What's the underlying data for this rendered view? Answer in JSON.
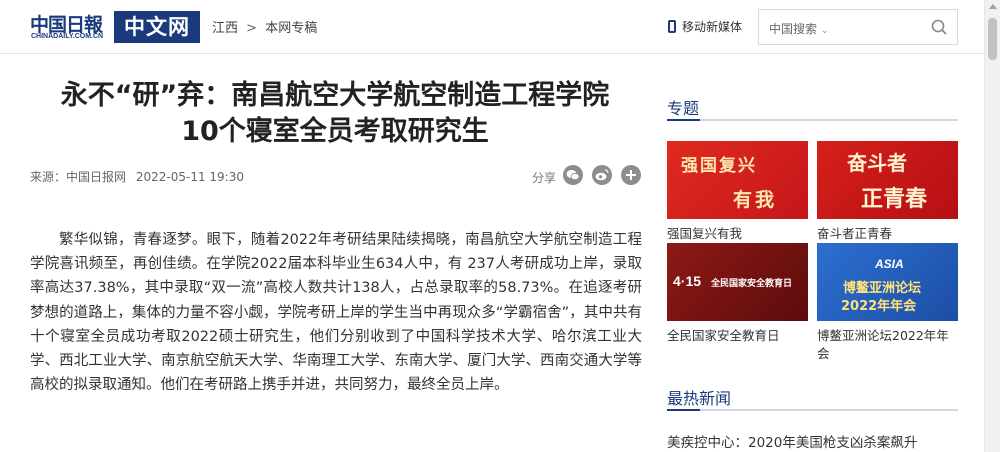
{
  "header": {
    "logo_cn": "中国日報",
    "logo_url_text": "CHINADAILY.COM.CN",
    "logo_zwb": "中文网",
    "breadcrumb": [
      "江西",
      "本网专稿"
    ],
    "breadcrumb_sep": ">",
    "mobile_label": "移动新媒体",
    "search_placeholder": "中国搜索"
  },
  "article": {
    "title_line1": "永不“研”弃：南昌航空大学航空制造工程学院",
    "title_line2": "10个寝室全员考取研究生",
    "source": "来源：中国日报网",
    "datetime": "2022-05-11 19:30",
    "share_label": "分享",
    "body": "繁华似锦，青春逐梦。眼下，随着2022年考研结果陆续揭晓，南昌航空大学航空制造工程学院喜讯频至，再创佳绩。在学院2022届本科毕业生634人中，有 237人考研成功上岸，录取率高达37.38%，其中录取“双一流”高校人数共计138人，占总录取率的58.73%。在追逐考研梦想的道路上，集体的力量不容小觑，学院考研上岸的学生当中再现众多“学霸宿舍”，其中共有十个寝室全员成功考取2022硕士研究生，他们分别收到了中国科学技术大学、哈尔滨工业大学、西北工业大学、南京航空航天大学、华南理工大学、东南大学、厦门大学、西南交通大学等高校的拟录取通知。他们在考研路上携手并进，共同努力，最终全员上岸。"
  },
  "sidebar": {
    "topics_heading": "专题",
    "topics": [
      {
        "caption": "强国复兴有我",
        "img_text1": "强国复兴",
        "img_text2": "有我"
      },
      {
        "caption": "奋斗者正青春",
        "img_text1": "奋斗者",
        "img_text2": "正青春"
      },
      {
        "caption": "全民国家安全教育日",
        "img_text1": "4·15",
        "img_text2": "全民国家安全教育日"
      },
      {
        "caption": "博鳌亚洲论坛2022年年会",
        "img_text1": "ASIA",
        "img_text2": "博鳌亚洲论坛",
        "img_text3": "2022年年会"
      }
    ],
    "hot_heading": "最热新闻",
    "hot_news": [
      "美疾控中心：2020年美国枪支凶杀案飙升"
    ]
  },
  "colors": {
    "brand_blue": "#1a3a7c",
    "topic_red": "#d6201a",
    "topic_blue": "#2d6fd1"
  }
}
